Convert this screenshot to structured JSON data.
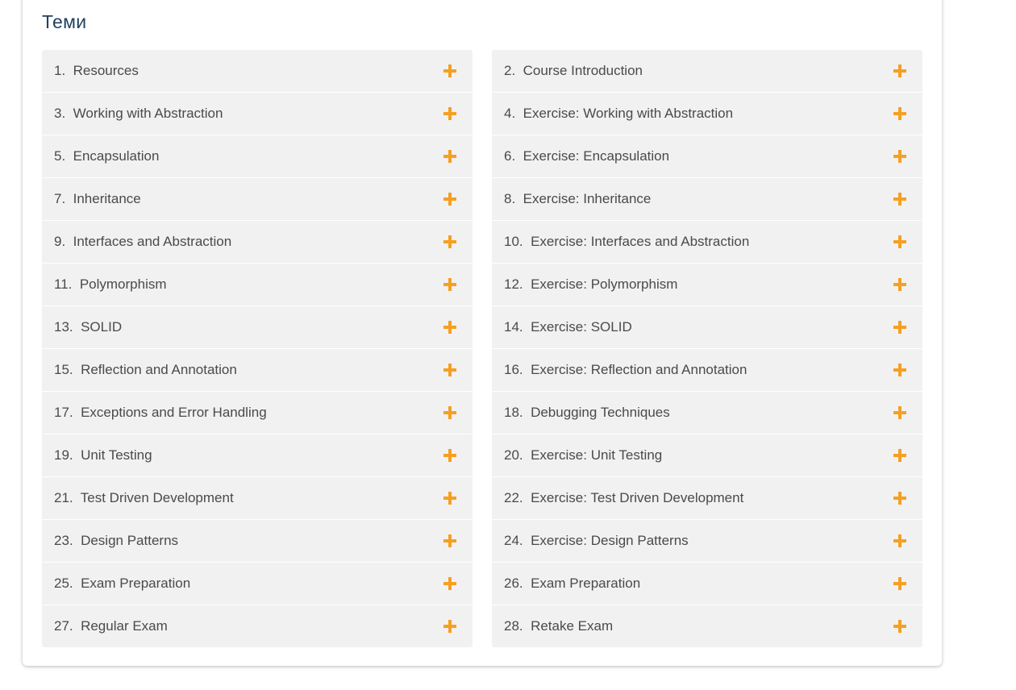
{
  "section": {
    "title": "Теми"
  },
  "colors": {
    "accent": "#f5a023",
    "title": "#23405f",
    "item_bg": "#f1f1f1",
    "item_text": "#4a4a4a"
  },
  "topics": {
    "left": [
      "1.  Resources",
      "3.  Working with Abstraction",
      "5.  Encapsulation",
      "7.  Inheritance",
      "9.  Interfaces and Abstraction",
      "11.  Polymorphism",
      "13.  SOLID",
      "15.  Reflection and Annotation",
      "17.  Exceptions and Error Handling",
      "19.  Unit Testing",
      "21.  Test Driven Development",
      "23.  Design Patterns",
      "25.  Exam Preparation",
      "27.  Regular Exam"
    ],
    "right": [
      "2.  Course Introduction",
      "4.  Exercise: Working with Abstraction",
      "6.  Exercise: Encapsulation",
      "8.  Exercise: Inheritance",
      "10.  Exercise: Interfaces and Abstraction",
      "12.  Exercise: Polymorphism",
      "14.  Exercise: SOLID",
      "16.  Exercise: Reflection and Annotation",
      "18.  Debugging Techniques",
      "20.  Exercise: Unit Testing",
      "22.  Exercise: Test Driven Development",
      "24.  Exercise: Design Patterns",
      "26.  Exam Preparation",
      "28.  Retake Exam"
    ]
  },
  "icons": {
    "expand": "plus-icon"
  }
}
